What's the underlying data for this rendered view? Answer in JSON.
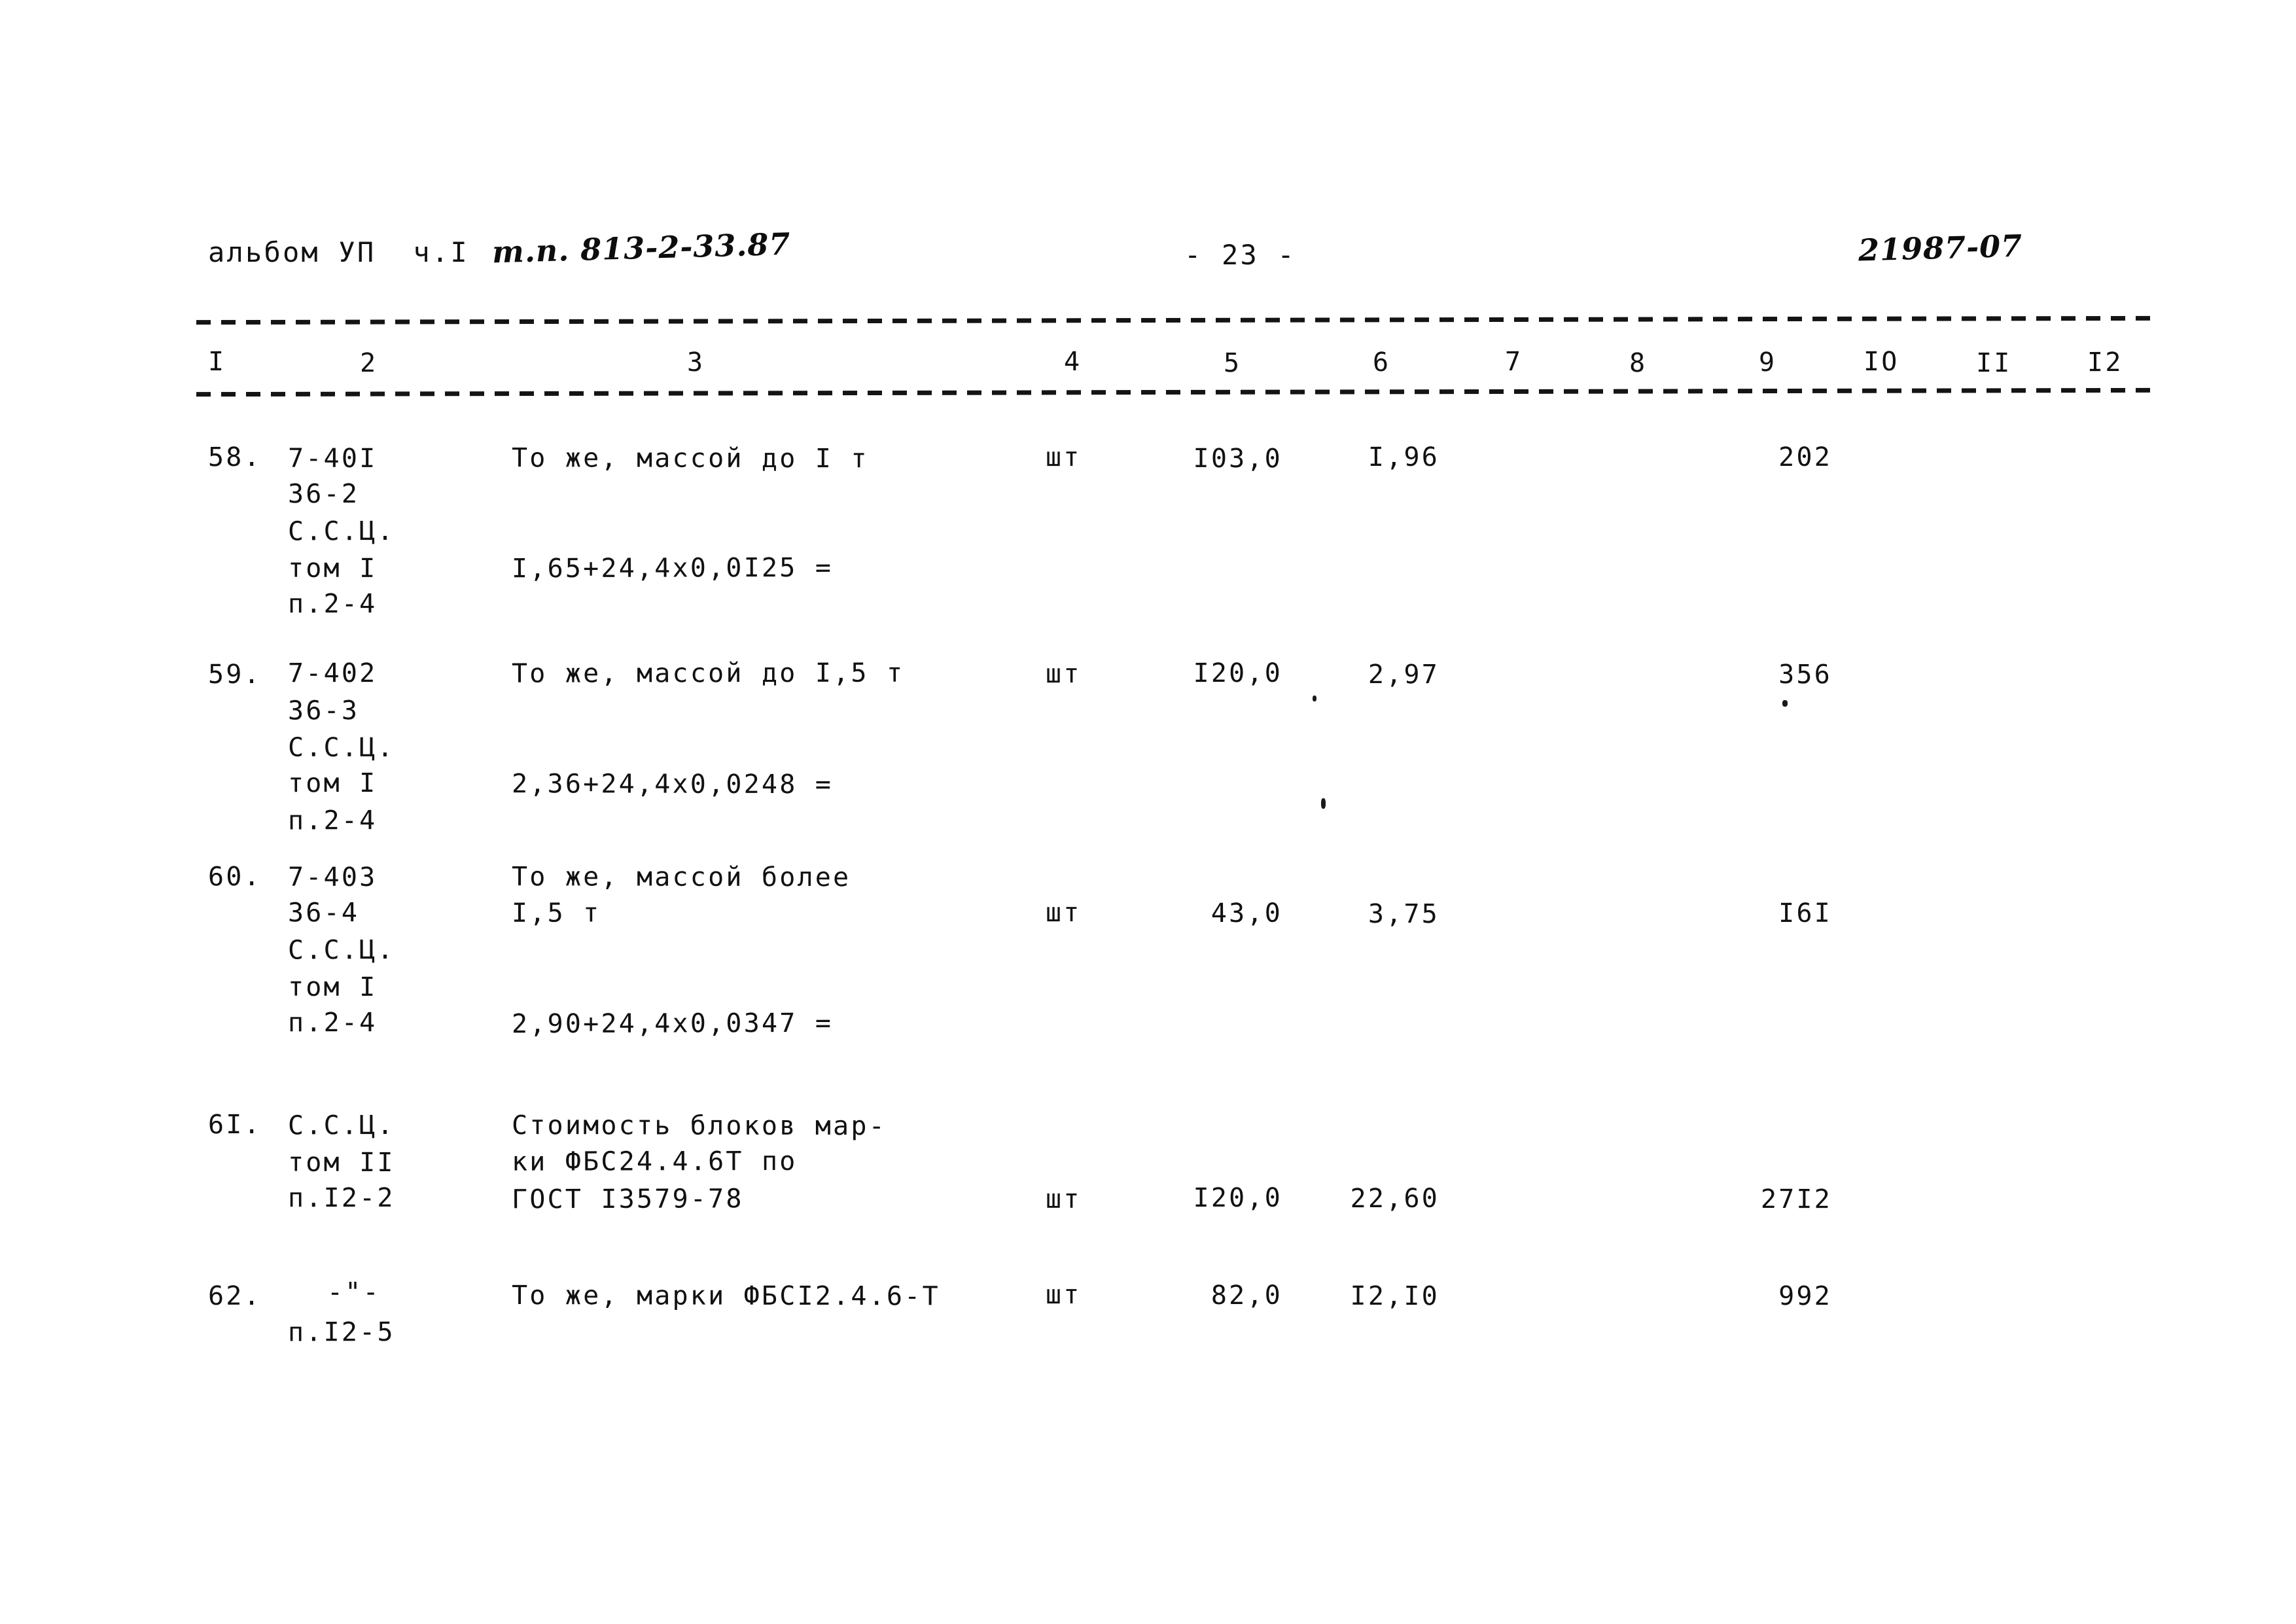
{
  "document": {
    "header_left_typed": "альбом УП  ч.I",
    "header_left_handwritten": "т.п. 813-2-33.87",
    "page_marker": "- 23 -",
    "header_right_handwritten": "21987-07"
  },
  "table": {
    "column_numbers": [
      "I",
      "2",
      "3",
      "4",
      "5",
      "6",
      "7",
      "8",
      "9",
      "IO",
      "II",
      "I2"
    ],
    "rows": [
      {
        "no": "58.",
        "code_lines": [
          "7-40I",
          "36-2",
          "С.С.Ц.",
          "том I",
          "п.2-4"
        ],
        "desc_lines": [
          "То же, массой до I т"
        ],
        "formula": "I,65+24,4х0,0I25 =",
        "unit": "шт",
        "qty": "I03,0",
        "price": "I,96",
        "col7": "",
        "col8": "",
        "total": "202",
        "col10": "",
        "col11": "",
        "col12": ""
      },
      {
        "no": "59.",
        "code_lines": [
          "7-402",
          "36-3",
          "С.С.Ц.",
          "том I",
          "п.2-4"
        ],
        "desc_lines": [
          "То же, массой до I,5 т"
        ],
        "formula": "2,36+24,4х0,0248 =",
        "unit": "шт",
        "qty": "I20,0",
        "price": "2,97",
        "col7": "",
        "col8": "",
        "total": "356",
        "col10": "",
        "col11": "",
        "col12": ""
      },
      {
        "no": "60.",
        "code_lines": [
          "7-403",
          "36-4",
          "С.С.Ц.",
          "том I",
          "п.2-4"
        ],
        "desc_lines": [
          "То же, массой более",
          "I,5 т"
        ],
        "formula": "2,90+24,4х0,0347 =",
        "unit": "шт",
        "qty": "43,0",
        "price": "3,75",
        "col7": "",
        "col8": "",
        "total": "I6I",
        "col10": "",
        "col11": "",
        "col12": ""
      },
      {
        "no": "6I.",
        "code_lines": [
          "С.С.Ц.",
          "том II",
          "п.I2-2"
        ],
        "desc_lines": [
          "Стоимость блоков мар-",
          "ки ФБС24.4.6Т по",
          "ГОСТ I3579-78"
        ],
        "formula": "",
        "unit": "шт",
        "qty": "I20,0",
        "price": "22,60",
        "col7": "",
        "col8": "",
        "total": "27I2",
        "col10": "",
        "col11": "",
        "col12": ""
      },
      {
        "no": "62.",
        "code_lines": [
          "-\"-",
          "п.I2-5"
        ],
        "desc_lines": [
          "То же, марки ФБСI2.4.6-Т"
        ],
        "formula": "",
        "unit": "шт",
        "qty": "82,0",
        "price": "I2,I0",
        "col7": "",
        "col8": "",
        "total": "992",
        "col10": "",
        "col11": "",
        "col12": ""
      }
    ]
  }
}
